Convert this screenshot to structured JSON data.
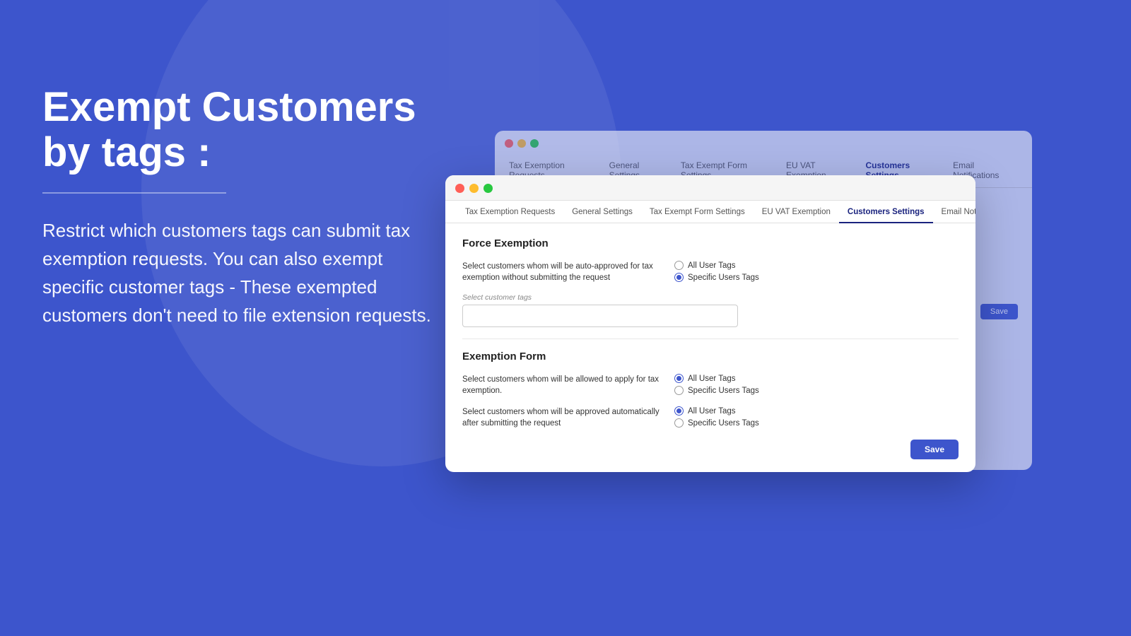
{
  "background": {
    "color": "#3d55cc"
  },
  "left_panel": {
    "heading": "Exempt Customers by tags :",
    "body": "Restrict which customers tags can submit tax exemption requests.  You can also exempt specific customer tags - These exempted customers don't need to file extension requests."
  },
  "bg_window": {
    "tabs": [
      "Tax Exemption Requests",
      "General Settings",
      "Tax Exempt Form Settings",
      "EU VAT Exemption",
      "Customers Settings",
      "Email Notifications"
    ]
  },
  "main_window": {
    "tabs": [
      {
        "label": "Tax Exemption Requests",
        "active": false
      },
      {
        "label": "General Settings",
        "active": false
      },
      {
        "label": "Tax Exempt Form Settings",
        "active": false
      },
      {
        "label": "EU VAT Exemption",
        "active": false
      },
      {
        "label": "Customers Settings",
        "active": true
      },
      {
        "label": "Email Notifications",
        "active": false
      }
    ],
    "sections": {
      "force_exemption": {
        "title": "Force Exemption",
        "field1_label": "Select customers whom will be auto-approved for tax exemption without submitting the request",
        "field1_options": [
          {
            "label": "All User Tags",
            "checked": false
          },
          {
            "label": "Specific Users Tags",
            "checked": true
          }
        ],
        "tag_input_placeholder": "Select customer tags"
      },
      "exemption_form": {
        "title": "Exemption Form",
        "field1_label": "Select customers whom will be allowed to apply for tax exemption.",
        "field1_options": [
          {
            "label": "All User Tags",
            "checked": true
          },
          {
            "label": "Specific Users Tags",
            "checked": false
          }
        ],
        "field2_label": "Select customers whom will be approved automatically after submitting the request",
        "field2_options": [
          {
            "label": "All User Tags",
            "checked": true
          },
          {
            "label": "Specific Users Tags",
            "checked": false
          }
        ]
      }
    },
    "save_button": "Save"
  }
}
